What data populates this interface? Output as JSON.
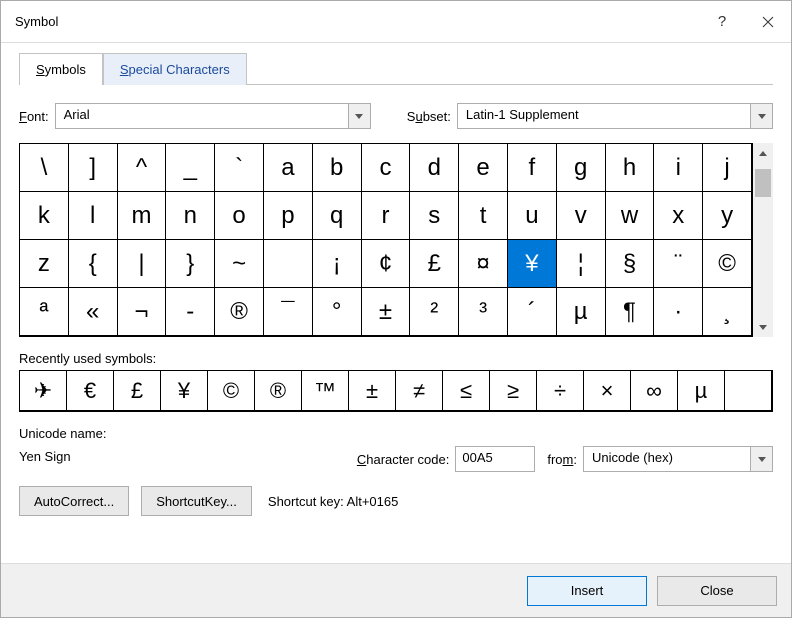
{
  "titlebar": {
    "title": "Symbol"
  },
  "tabs": {
    "symbols": "Symbols",
    "special": "Special Characters"
  },
  "labels": {
    "font": "Font:",
    "subset": "Subset:",
    "recent": "Recently used symbols:",
    "unicode_name": "Unicode name:",
    "char_code": "Character code:",
    "from": "from:",
    "shortcut_key_text": "Shortcut key: Alt+0165"
  },
  "combos": {
    "font": "Arial",
    "subset": "Latin-1 Supplement",
    "from": "Unicode (hex)"
  },
  "unicode_name_value": "Yen Sign",
  "char_code_value": "00A5",
  "buttons": {
    "autocorrect": "AutoCorrect...",
    "shortcut_key": "Shortcut Key...",
    "insert": "Insert",
    "close": "Close"
  },
  "main_grid": [
    "\\",
    "]",
    "^",
    "_",
    "`",
    "a",
    "b",
    "c",
    "d",
    "e",
    "f",
    "g",
    "h",
    "i",
    "j",
    "k",
    "l",
    "m",
    "n",
    "o",
    "p",
    "q",
    "r",
    "s",
    "t",
    "u",
    "v",
    "w",
    "x",
    "y",
    "z",
    "{",
    "|",
    "}",
    "~",
    "",
    "¡",
    "¢",
    "£",
    "¤",
    "¥",
    "¦",
    "§",
    "¨",
    "©",
    "ª",
    "«",
    "¬",
    "-",
    "®",
    "¯",
    "°",
    "±",
    "²",
    "³",
    "´",
    "µ",
    "¶",
    "·",
    "¸"
  ],
  "selected_index": 40,
  "recent": [
    "✈",
    "€",
    "£",
    "¥",
    "©",
    "®",
    "™",
    "±",
    "≠",
    "≤",
    "≥",
    "÷",
    "×",
    "∞",
    "µ",
    ""
  ]
}
